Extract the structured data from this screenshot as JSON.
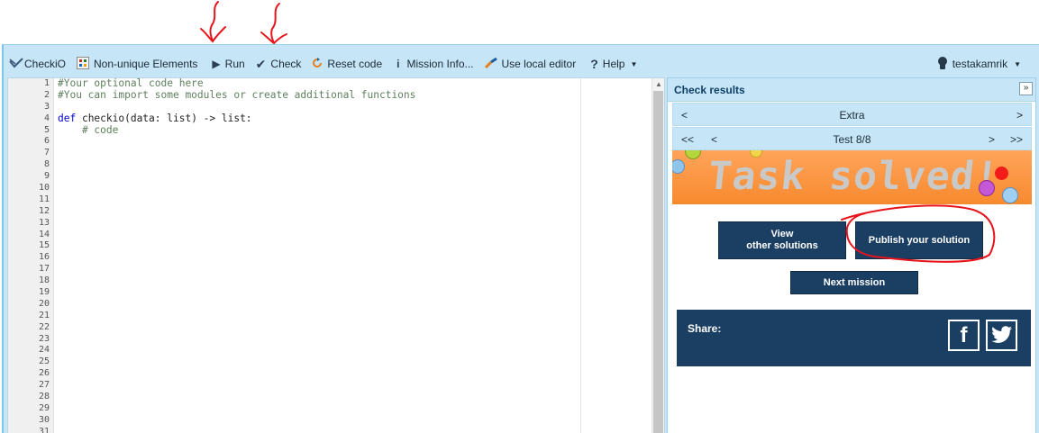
{
  "toolbar": {
    "logo": "CheckiO",
    "items": [
      "Non-unique Elements",
      "Run",
      "Check",
      "Reset code",
      "Mission Info...",
      "Use local editor",
      "Help"
    ],
    "user": "testakamrik"
  },
  "editor": {
    "line_numbers": [
      "1",
      "2",
      "3",
      "4",
      "5",
      "6",
      "7",
      "8",
      "9",
      "10",
      "11",
      "12",
      "13",
      "14",
      "15",
      "16",
      "17",
      "18",
      "19",
      "20",
      "21",
      "22",
      "23",
      "24",
      "25",
      "26",
      "27",
      "28",
      "29",
      "30",
      "31"
    ],
    "lines": [
      "#Your optional code here",
      "#You can import some modules or create additional functions",
      "",
      "def checkio(data: list) -> list:",
      "    # code"
    ]
  },
  "results": {
    "title": "Check results",
    "collapse": "»",
    "category": {
      "prev": "<",
      "label": "Extra",
      "next": ">"
    },
    "test": {
      "first": "<<",
      "prev": "<",
      "label": "Test 8/8",
      "next": ">",
      "last": ">>"
    },
    "banner": "Task solved!",
    "buttons": {
      "view_line1": "View",
      "view_line2": "other solutions",
      "publish": "Publish your solution",
      "next": "Next mission"
    },
    "share": {
      "label": "Share:",
      "facebook": "f"
    }
  },
  "colors": {
    "toolbar_bg": "#c6e6f7",
    "button_bg": "#1b3e63",
    "banner": "#f78a2f",
    "annotation": "#e8141c"
  }
}
